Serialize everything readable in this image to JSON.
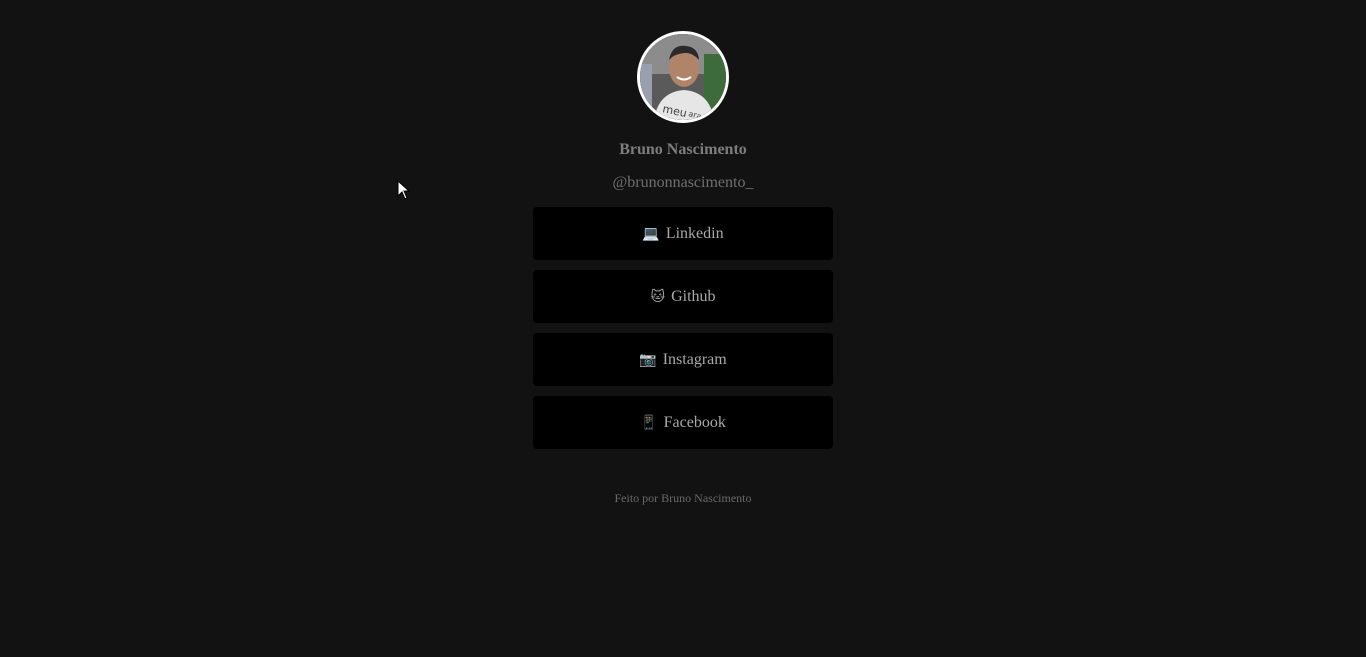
{
  "profile": {
    "name": "Bruno Nascimento",
    "handle": "@brunonnascimento_"
  },
  "links": [
    {
      "emoji": "💻",
      "icon": "laptop-icon",
      "label": "Linkedin"
    },
    {
      "emoji": "🐱",
      "icon": "cat-icon",
      "label": "Github"
    },
    {
      "emoji": "📷",
      "icon": "camera-icon",
      "label": "Instagram"
    },
    {
      "emoji": "📱",
      "icon": "phone-icon",
      "label": "Facebook"
    }
  ],
  "footer": {
    "text": "Feito por Bruno Nascimento"
  },
  "colors": {
    "background": "#121212",
    "button": "#000000",
    "avatar_border": "#ffffff"
  }
}
